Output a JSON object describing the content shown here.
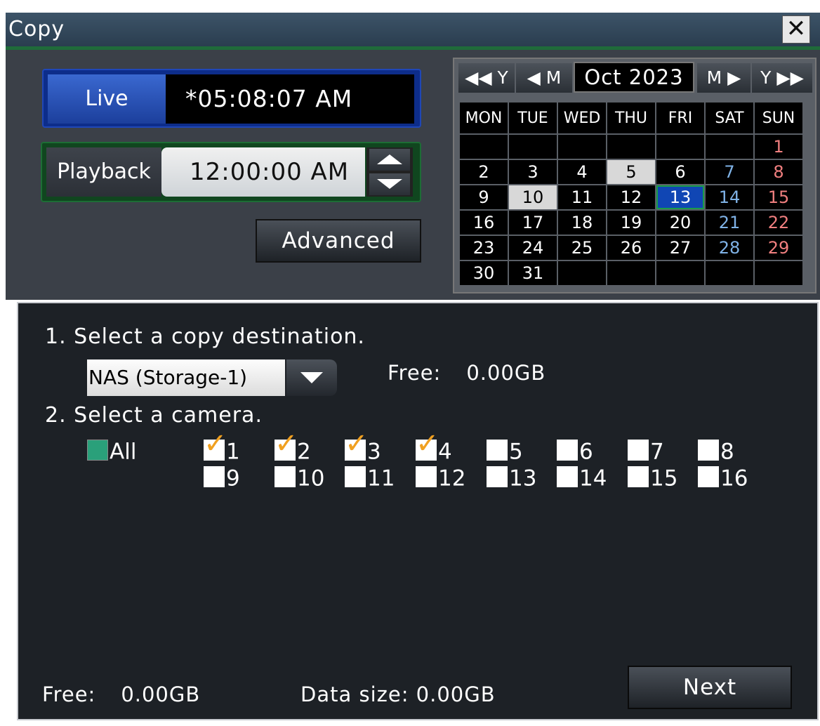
{
  "window": {
    "title": "Copy",
    "close_icon": "close-icon"
  },
  "time": {
    "live_label": "Live",
    "live_time": "*05:08:07 AM",
    "playback_label": "Playback",
    "playback_time": "12:00:00 AM",
    "advanced_label": "Advanced"
  },
  "calendar": {
    "prev_year": "◀◀ Y",
    "prev_month": "◀ M",
    "month_label": "Oct 2023",
    "next_month": "M ▶",
    "next_year": "Y ▶▶",
    "weekdays": [
      "MON",
      "TUE",
      "WED",
      "THU",
      "FRI",
      "SAT",
      "SUN"
    ],
    "weeks": [
      [
        "",
        "",
        "",
        "",
        "",
        "",
        "1"
      ],
      [
        "2",
        "3",
        "4",
        "5",
        "6",
        "7",
        "8"
      ],
      [
        "9",
        "10",
        "11",
        "12",
        "13",
        "14",
        "15"
      ],
      [
        "16",
        "17",
        "18",
        "19",
        "20",
        "21",
        "22"
      ],
      [
        "23",
        "24",
        "25",
        "26",
        "27",
        "28",
        "29"
      ],
      [
        "30",
        "31",
        "",
        "",
        "",
        "",
        ""
      ]
    ],
    "highlighted_days": [
      "5",
      "10"
    ],
    "selected_day": "13",
    "colors": {
      "saturday": "#7fb2e6",
      "sunday": "#f07f7f",
      "selected": "#1046b4"
    }
  },
  "copy": {
    "step1": "1. Select a copy destination.",
    "destination": "NAS (Storage-1)",
    "free_label": "Free:",
    "free_value": "0.00GB",
    "step2": "2. Select a camera.",
    "all_label": "All",
    "cameras": [
      {
        "label": "1",
        "checked": true
      },
      {
        "label": "2",
        "checked": true
      },
      {
        "label": "3",
        "checked": true
      },
      {
        "label": "4",
        "checked": true
      },
      {
        "label": "5",
        "checked": false
      },
      {
        "label": "6",
        "checked": false
      },
      {
        "label": "7",
        "checked": false
      },
      {
        "label": "8",
        "checked": false
      },
      {
        "label": "9",
        "checked": false
      },
      {
        "label": "10",
        "checked": false
      },
      {
        "label": "11",
        "checked": false
      },
      {
        "label": "12",
        "checked": false
      },
      {
        "label": "13",
        "checked": false
      },
      {
        "label": "14",
        "checked": false
      },
      {
        "label": "15",
        "checked": false
      },
      {
        "label": "16",
        "checked": false
      }
    ],
    "bottom_free_label": "Free:",
    "bottom_free_value": "0.00GB",
    "data_size": "Data size: 0.00GB",
    "next_label": "Next"
  }
}
